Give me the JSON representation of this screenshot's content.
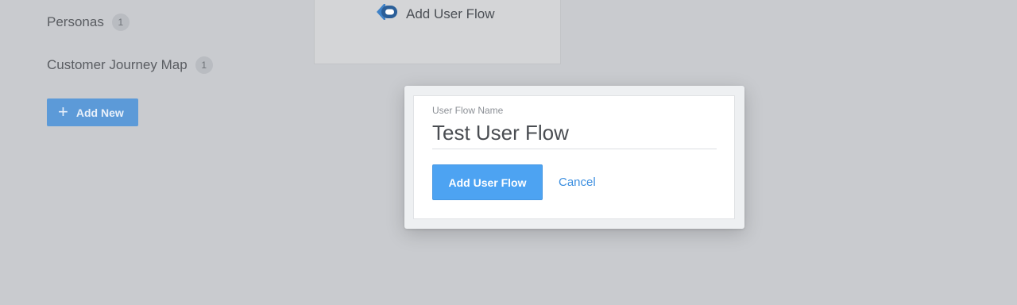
{
  "sidebar": {
    "items": [
      {
        "label": "Personas",
        "count": "1"
      },
      {
        "label": "Customer Journey Map",
        "count": "1"
      }
    ],
    "add_new_label": "Add New"
  },
  "card": {
    "link_label": "Add User Flow",
    "icon": "user-flow-icon"
  },
  "modal": {
    "field_label": "User Flow Name",
    "field_value": "Test User Flow",
    "submit_label": "Add User Flow",
    "cancel_label": "Cancel"
  },
  "colors": {
    "background": "#c9cbcf",
    "primary": "#4da3f2",
    "add_new": "#5c9ad8",
    "link": "#3d8fe0"
  }
}
